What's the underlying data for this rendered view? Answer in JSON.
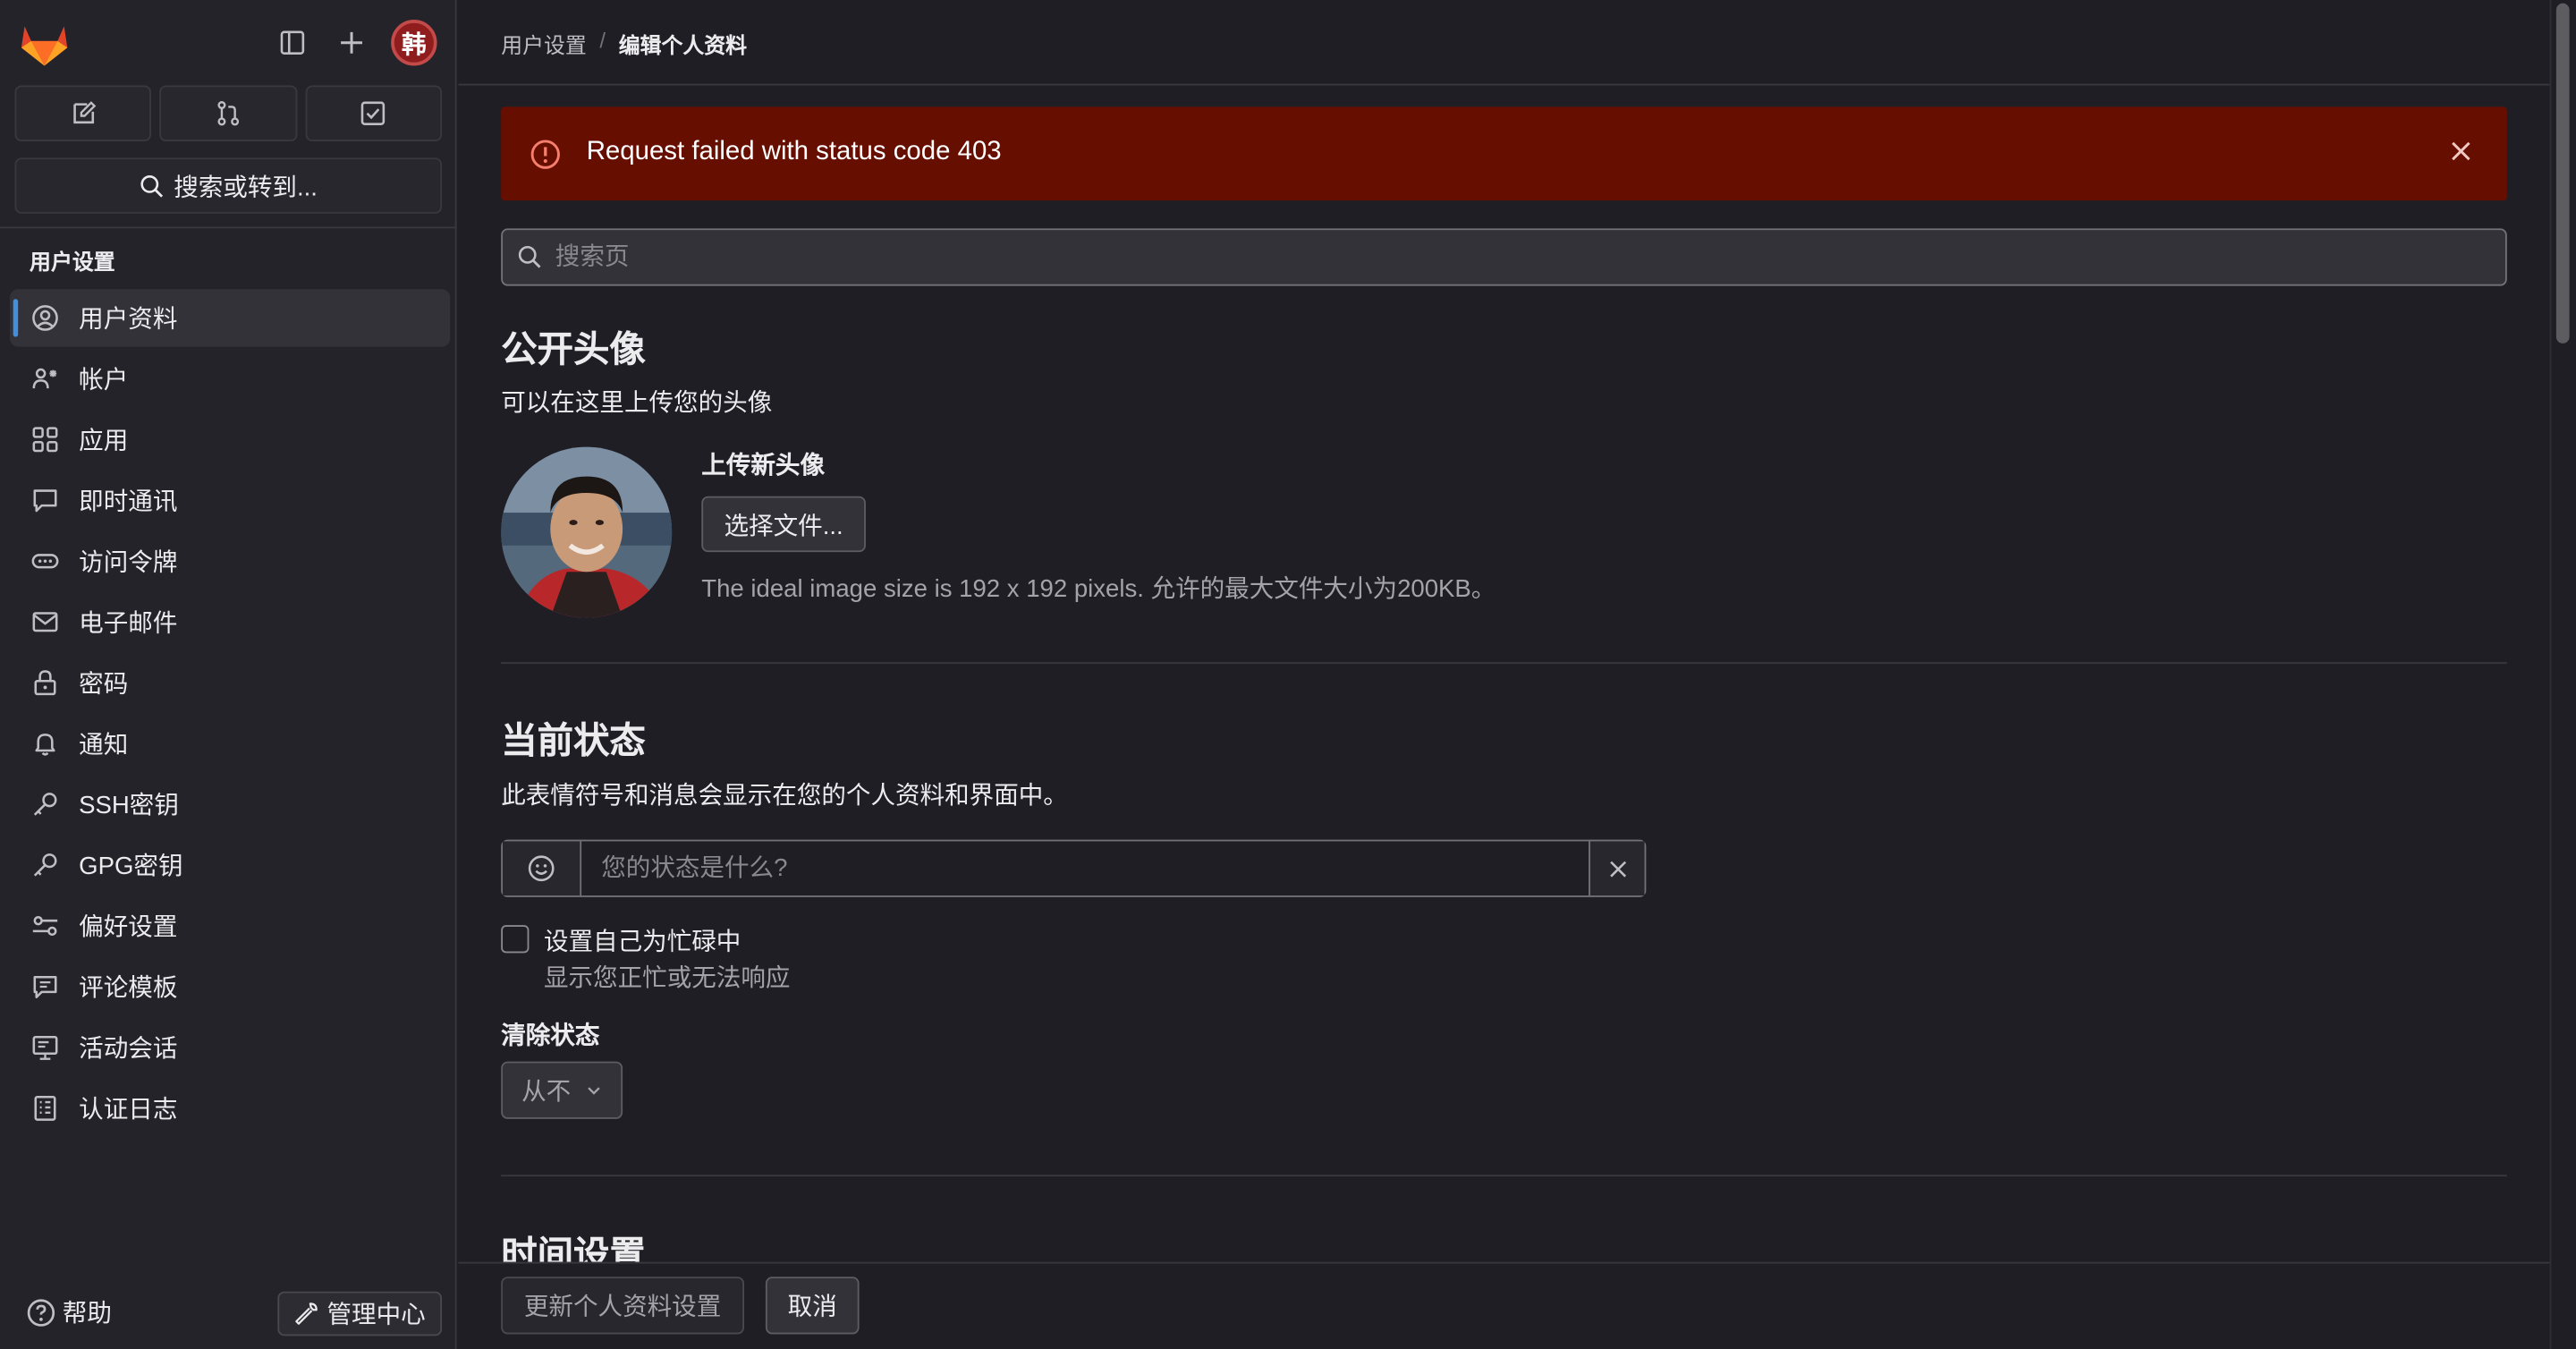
{
  "sidebar": {
    "avatar_char": "韩",
    "search_label": "搜索或转到...",
    "section_title": "用户设置",
    "items": [
      {
        "label": "用户资料",
        "icon": "user-circle-icon",
        "active": true
      },
      {
        "label": "帐户",
        "icon": "account-gear-icon"
      },
      {
        "label": "应用",
        "icon": "applications-grid-icon"
      },
      {
        "label": "即时通讯",
        "icon": "comment-bubble-icon"
      },
      {
        "label": "访问令牌",
        "icon": "token-icon"
      },
      {
        "label": "电子邮件",
        "icon": "envelope-icon"
      },
      {
        "label": "密码",
        "icon": "lock-icon"
      },
      {
        "label": "通知",
        "icon": "bell-icon"
      },
      {
        "label": "SSH密钥",
        "icon": "key-icon"
      },
      {
        "label": "GPG密钥",
        "icon": "key-icon"
      },
      {
        "label": "偏好设置",
        "icon": "preferences-icon"
      },
      {
        "label": "评论模板",
        "icon": "comment-lines-icon"
      },
      {
        "label": "活动会话",
        "icon": "monitor-icon"
      },
      {
        "label": "认证日志",
        "icon": "log-icon"
      }
    ],
    "help_label": "帮助",
    "admin_label": "管理中心"
  },
  "breadcrumb": {
    "parent": "用户设置",
    "separator": "/",
    "current": "编辑个人资料"
  },
  "alert": {
    "message": "Request failed with status code 403",
    "color": "#660e00"
  },
  "page_search": {
    "placeholder": "搜索页"
  },
  "avatar_section": {
    "title": "公开头像",
    "description": "可以在这里上传您的头像",
    "upload_title": "上传新头像",
    "choose_button": "选择文件...",
    "help": "The ideal image size is 192 x 192 pixels. 允许的最大文件大小为200KB。"
  },
  "status_section": {
    "title": "当前状态",
    "description": "此表情符号和消息会显示在您的个人资料和界面中。",
    "placeholder": "您的状态是什么?",
    "busy_label": "设置自己为忙碌中",
    "busy_help": "显示您正忙或无法响应",
    "clear_label": "清除状态",
    "clear_value": "从不"
  },
  "time_section": {
    "title": "时间设置"
  },
  "footer": {
    "update_button": "更新个人资料设置",
    "cancel_button": "取消"
  },
  "colors": {
    "background": "#1f1e24",
    "sidebar": "#242329",
    "accent": "#428fdc",
    "alert": "#660e00"
  }
}
